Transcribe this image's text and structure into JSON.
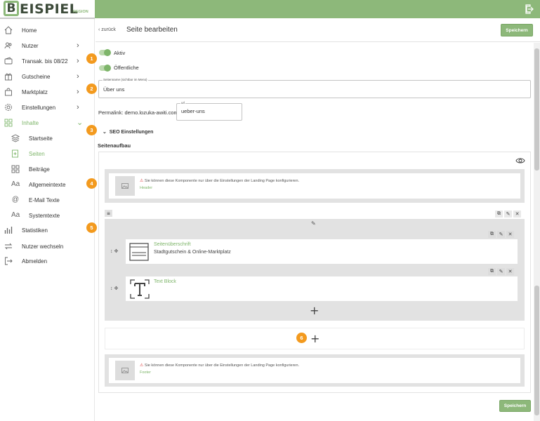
{
  "logo": {
    "letter": "B",
    "text": "EISPIEL",
    "region": "REGION"
  },
  "topbar": {
    "logout_icon": "logout-icon"
  },
  "sidebar": {
    "items": [
      {
        "label": "Home",
        "icon": "home-icon"
      },
      {
        "label": "Nutzer",
        "icon": "users-icon"
      },
      {
        "label": "Transak. bis 08/22",
        "icon": "wallet-icon"
      },
      {
        "label": "Gutscheine",
        "icon": "gift-icon"
      },
      {
        "label": "Marktplatz",
        "icon": "shopping-bag-icon"
      },
      {
        "label": "Einstellungen",
        "icon": "gear-icon"
      },
      {
        "label": "Inhalte",
        "icon": "grid-icon"
      },
      {
        "label": "Startseite",
        "icon": "layers-icon"
      },
      {
        "label": "Seiten",
        "icon": "page-add-icon"
      },
      {
        "label": "Beiträge",
        "icon": "grid-icon"
      },
      {
        "label": "Allgemeintexte",
        "icon": "text-icon"
      },
      {
        "label": "E-Mail Texte",
        "icon": "at-icon"
      },
      {
        "label": "Systemtexte",
        "icon": "text-icon"
      },
      {
        "label": "Statistiken",
        "icon": "bar-chart-icon"
      },
      {
        "label": "Nutzer wechseln",
        "icon": "switch-icon"
      },
      {
        "label": "Abmelden",
        "icon": "logout-icon"
      }
    ]
  },
  "header": {
    "back": "zurück",
    "title": "Seite bearbeiten",
    "save": "Speichern"
  },
  "form": {
    "aktiv_label": "Aktiv",
    "oeffentlich_label": "Öffentliche",
    "seitenname_legend": "Seitenname (sichtbar im Menü)",
    "seitenname_value": "Über uns",
    "permalink_label": "Permalink: demo.lozuka-awiti.com/",
    "url_legend": "url",
    "url_value": "ueber-uns",
    "seo_label": "SEO Einstellungen",
    "seitenaufbau": "Seitenaufbau"
  },
  "builder": {
    "header_warning": "Sie können diese Komponente nur über die Einstellungen der Landing Page konfigurieren.",
    "header_name": "Header",
    "comp1_title": "Seitenüberschrift",
    "comp1_sub": "Stadtgutschein & Online-Marktplatz",
    "comp2_title": "Text Block",
    "footer_warning": "Sie können diese Komponente nur über die Einstellungen der Landing Page konfigurieren.",
    "footer_name": "Footer",
    "save_bottom": "Speichern"
  },
  "badges": [
    "1",
    "2",
    "3",
    "4",
    "5",
    "6"
  ],
  "colors": {
    "accent": "#8db87a",
    "badge": "#f39a1e",
    "warning": "#dd3333"
  }
}
